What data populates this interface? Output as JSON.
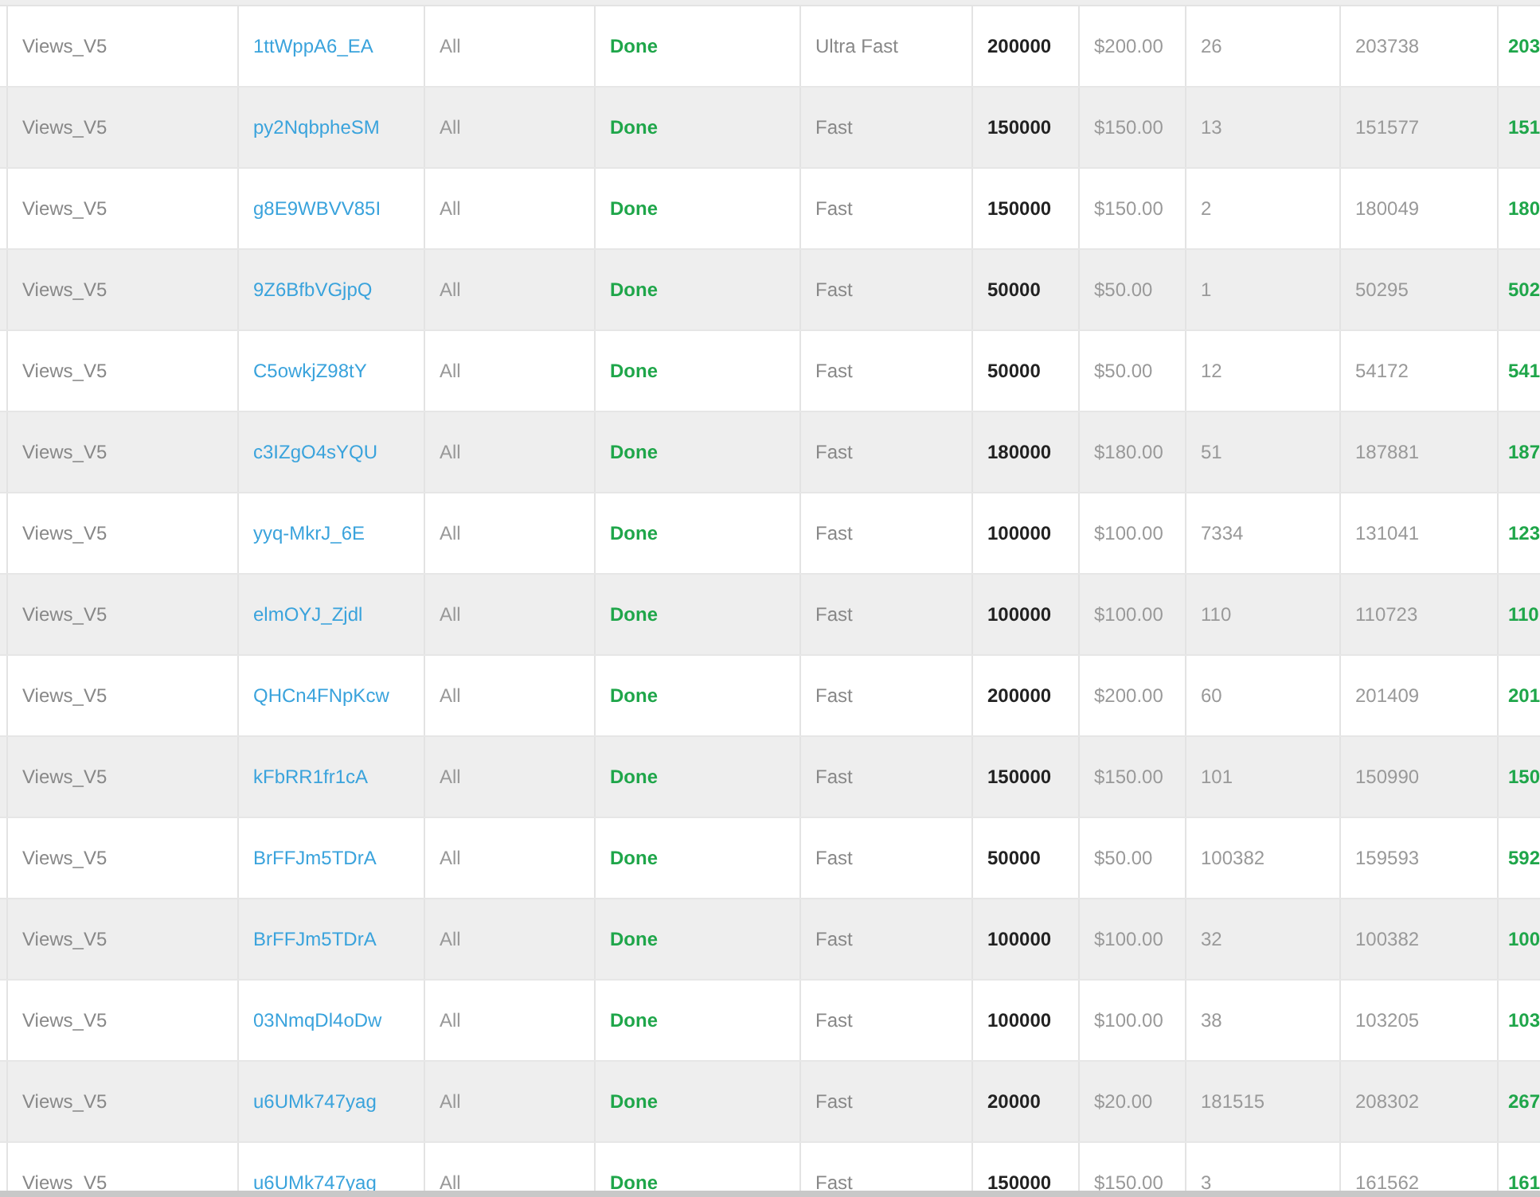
{
  "table": {
    "rows": [
      [
        "Views_V5",
        "1ttWppA6_EA",
        "All",
        "Done",
        "Ultra Fast",
        "200000",
        "$200.00",
        "26",
        "203738",
        "203"
      ],
      [
        "Views_V5",
        "py2NqbpheSM",
        "All",
        "Done",
        "Fast",
        "150000",
        "$150.00",
        "13",
        "151577",
        "151"
      ],
      [
        "Views_V5",
        "g8E9WBVV85I",
        "All",
        "Done",
        "Fast",
        "150000",
        "$150.00",
        "2",
        "180049",
        "180"
      ],
      [
        "Views_V5",
        "9Z6BfbVGjpQ",
        "All",
        "Done",
        "Fast",
        "50000",
        "$50.00",
        "1",
        "50295",
        "502"
      ],
      [
        "Views_V5",
        "C5owkjZ98tY",
        "All",
        "Done",
        "Fast",
        "50000",
        "$50.00",
        "12",
        "54172",
        "541"
      ],
      [
        "Views_V5",
        "c3IZgO4sYQU",
        "All",
        "Done",
        "Fast",
        "180000",
        "$180.00",
        "51",
        "187881",
        "187"
      ],
      [
        "Views_V5",
        "yyq-MkrJ_6E",
        "All",
        "Done",
        "Fast",
        "100000",
        "$100.00",
        "7334",
        "131041",
        "123"
      ],
      [
        "Views_V5",
        "elmOYJ_Zjdl",
        "All",
        "Done",
        "Fast",
        "100000",
        "$100.00",
        "110",
        "110723",
        "110"
      ],
      [
        "Views_V5",
        "QHCn4FNpKcw",
        "All",
        "Done",
        "Fast",
        "200000",
        "$200.00",
        "60",
        "201409",
        "201"
      ],
      [
        "Views_V5",
        "kFbRR1fr1cA",
        "All",
        "Done",
        "Fast",
        "150000",
        "$150.00",
        "101",
        "150990",
        "150"
      ],
      [
        "Views_V5",
        "BrFFJm5TDrA",
        "All",
        "Done",
        "Fast",
        "50000",
        "$50.00",
        "100382",
        "159593",
        "592"
      ],
      [
        "Views_V5",
        "BrFFJm5TDrA",
        "All",
        "Done",
        "Fast",
        "100000",
        "$100.00",
        "32",
        "100382",
        "100"
      ],
      [
        "Views_V5",
        "03NmqDl4oDw",
        "All",
        "Done",
        "Fast",
        "100000",
        "$100.00",
        "38",
        "103205",
        "103"
      ],
      [
        "Views_V5",
        "u6UMk747yag",
        "All",
        "Done",
        "Fast",
        "20000",
        "$20.00",
        "181515",
        "208302",
        "267"
      ],
      [
        "Views_V5",
        "u6UMk747yag",
        "All",
        "Done",
        "Fast",
        "150000",
        "$150.00",
        "3",
        "161562",
        "161"
      ]
    ]
  }
}
